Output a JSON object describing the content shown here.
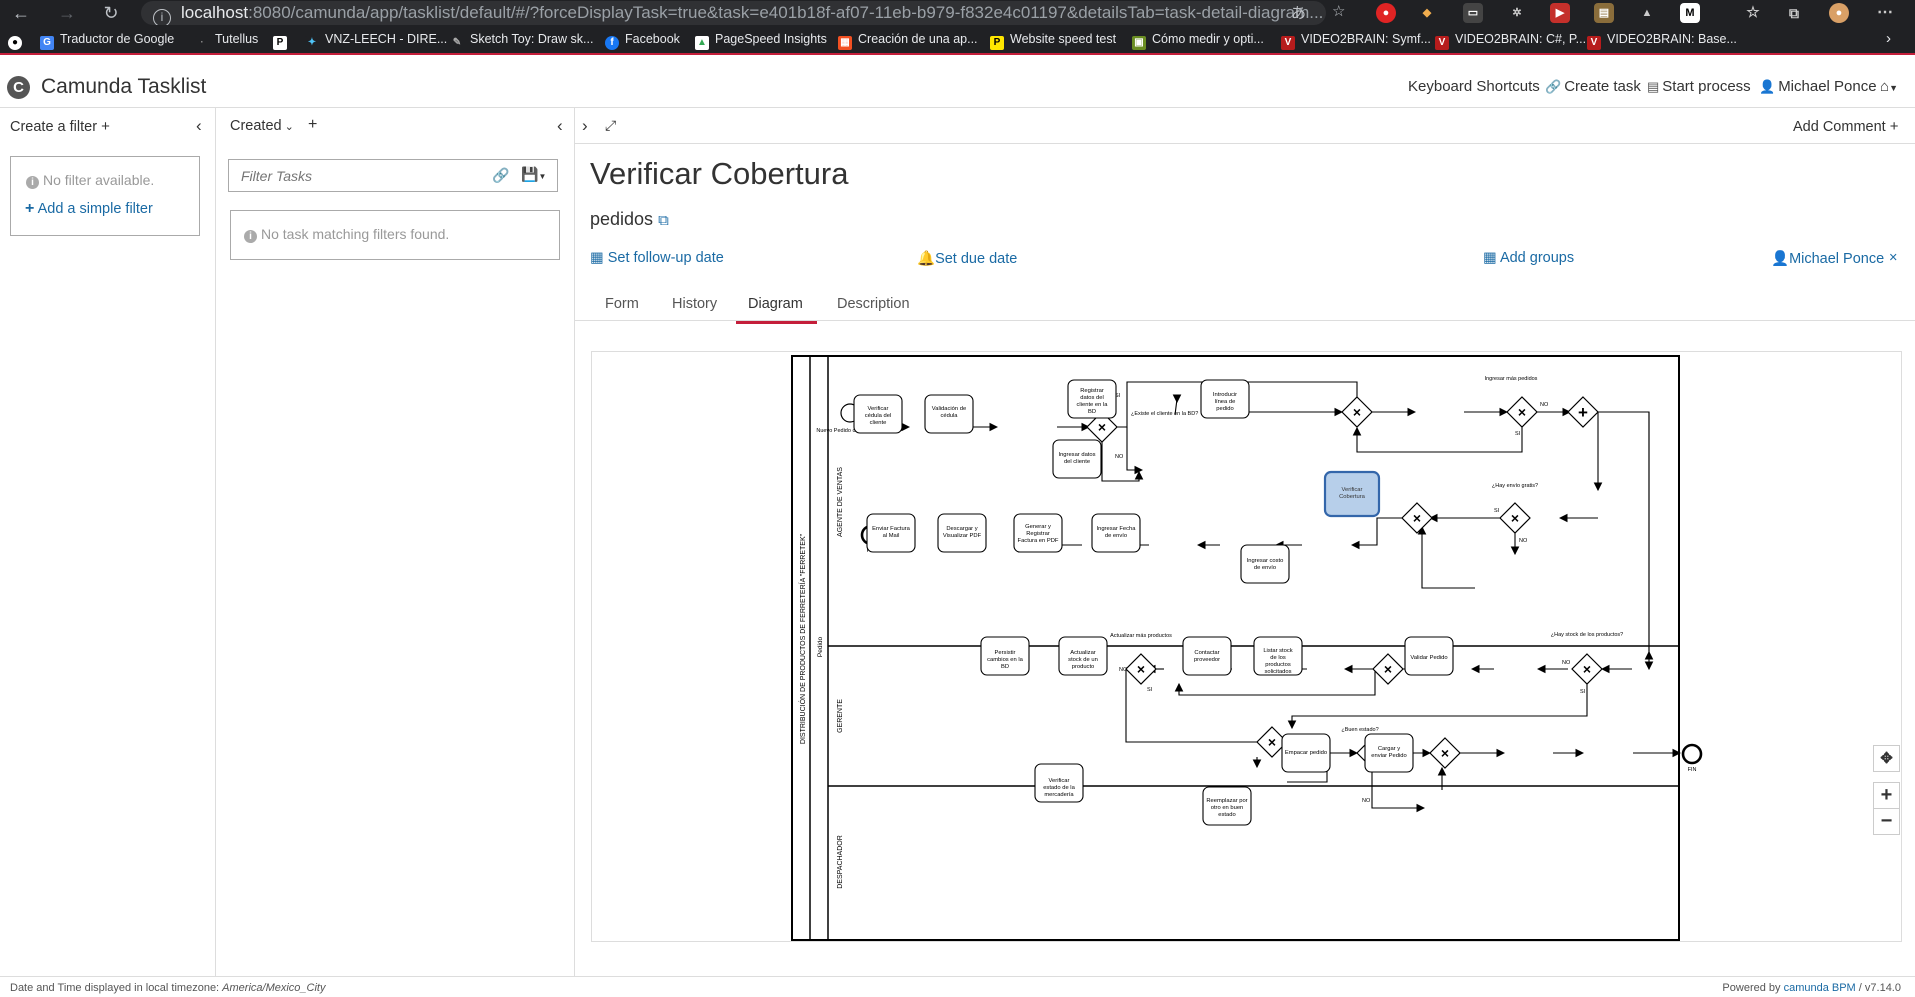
{
  "browser": {
    "url_host": "localhost",
    "url_path": ":8080/camunda/app/tasklist/default/#/?forceDisplayTask=true&task=e401b18f-af07-11eb-b979-f832e4c01197&detailsTab=task-detail-diagram...",
    "bookmarks": [
      "Traductor de Google",
      "Tutellus",
      "VNZ-LEECH - DIRE...",
      "Sketch Toy: Draw sk...",
      "Facebook",
      "PageSpeed Insights",
      "Creación de una ap...",
      "Website speed test",
      "Cómo medir y opti...",
      "VIDEO2BRAIN: Symf...",
      "VIDEO2BRAIN: C#, P...",
      "VIDEO2BRAIN: Base..."
    ]
  },
  "header": {
    "app_title": "Camunda Tasklist",
    "keyboard_shortcuts": "Keyboard Shortcuts",
    "create_task": "Create task",
    "start_process": "Start process",
    "user": "Michael Ponce"
  },
  "filters": {
    "create_filter": "Create a filter",
    "no_filter": "No filter available.",
    "add_simple_filter": "Add a simple filter"
  },
  "list": {
    "sort_label": "Created",
    "filter_placeholder": "Filter Tasks",
    "no_tasks": "No task matching filters found."
  },
  "detail": {
    "add_comment": "Add Comment",
    "task_title": "Verificar Cobertura",
    "process_name": "pedidos",
    "set_follow_up": "Set follow-up date",
    "set_due": "Set due date",
    "add_groups": "Add groups",
    "assignee": "Michael Ponce",
    "tabs": [
      "Form",
      "History",
      "Diagram",
      "Description"
    ]
  },
  "diagram": {
    "pool": "DISTRIBUCIÓN DE PRODUCTOS DE FERRETERÍA \"FERRETEK\"",
    "pool_sub": "Pedido",
    "lanes": [
      "AGENTE DE VENTAS",
      "GERENTE",
      "DESPACHADOR"
    ],
    "tasks": {
      "t1": "Verificar cédula del cliente",
      "t2": "Validación de cédula",
      "t3": "Registrar datos del cliente en la BD",
      "t4": "Ingresar datos del cliente",
      "t5": "Introducir línea de pedido",
      "t6": "Verificar Cobertura",
      "t7": "Ingresar costo de envío",
      "t8": "Ingresar Fecha de envío",
      "t9": "Generar y Registrar Factura en PDF",
      "t10": "Descargar y Visualizar PDF",
      "t11": "Enviar Factura al Mail",
      "t12": "Validar Pedido",
      "t13": "Listar stock de los productos solicitados",
      "t14": "Contactar proveedor",
      "t15": "Actualizar stock de un producto",
      "t16": "Persistir cambios en la BD",
      "t17": "Verificar estado de la mercadería",
      "t18": "Reemplazar por otro en buen estado",
      "t19": "Empacar pedido",
      "t20": "Cargar y enviar Pedido"
    },
    "labels": {
      "start": "Nuevo Pedido de un cliente",
      "end1": "FIN",
      "end2": "FIN",
      "g1": "¿Existe el cliente en la BD?",
      "g3": "Ingresar más pedidos",
      "g5": "¿Hay envío gratis?",
      "g7": "¿Hay stock de los productos?",
      "g9": "Actualizar más productos",
      "g11": "¿Buen estado?",
      "si": "SI",
      "no": "NO"
    }
  },
  "footer": {
    "tz_prefix": "Date and Time displayed in local timezone: ",
    "tz_value": "America/Mexico_City",
    "powered_prefix": "Powered by ",
    "powered_link": "camunda BPM",
    "version": " / v7.14.0"
  }
}
